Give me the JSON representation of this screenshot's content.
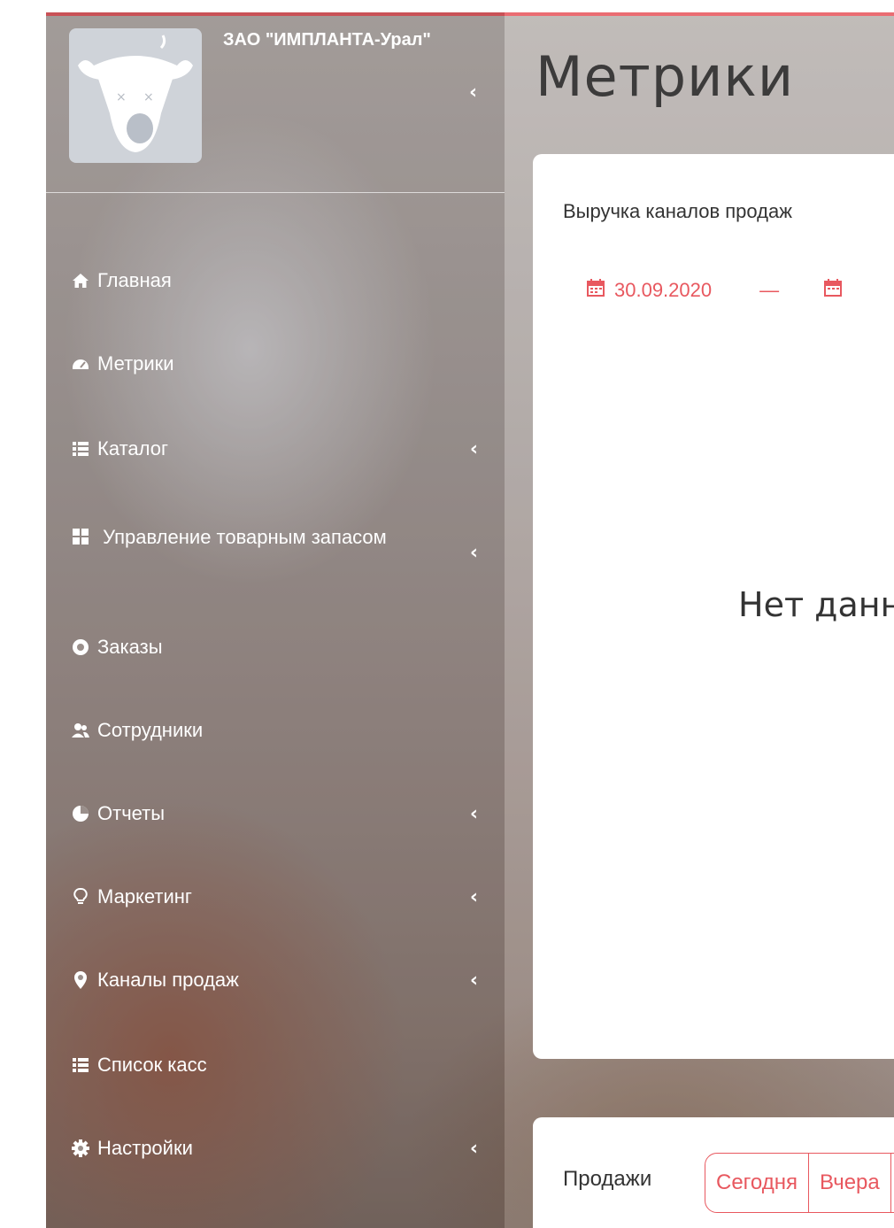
{
  "org": {
    "name": "ЗАО \"ИМПЛАНТА-Урал\""
  },
  "page": {
    "title": "Метрики"
  },
  "sidebar": {
    "items": [
      {
        "label": "Главная",
        "icon": "home-icon",
        "has_submenu": false
      },
      {
        "label": "Метрики",
        "icon": "gauge-icon",
        "has_submenu": false
      },
      {
        "label": "Каталог",
        "icon": "list-icon",
        "has_submenu": true
      },
      {
        "label": "Управление товарным запасом",
        "icon": "grid-icon",
        "has_submenu": true
      },
      {
        "label": "Заказы",
        "icon": "life-ring-icon",
        "has_submenu": false
      },
      {
        "label": "Сотрудники",
        "icon": "users-icon",
        "has_submenu": false
      },
      {
        "label": "Отчеты",
        "icon": "pie-chart-icon",
        "has_submenu": true
      },
      {
        "label": "Маркетинг",
        "icon": "lightbulb-icon",
        "has_submenu": true
      },
      {
        "label": "Каналы продаж",
        "icon": "map-marker-icon",
        "has_submenu": true
      },
      {
        "label": "Список касс",
        "icon": "list-icon",
        "has_submenu": false
      },
      {
        "label": "Настройки",
        "icon": "gear-icon",
        "has_submenu": true
      }
    ]
  },
  "revenue_card": {
    "title": "Выручка каналов продаж",
    "date_from": "30.09.2020",
    "date_separator": "—",
    "empty_text": "Нет данных"
  },
  "sales_card": {
    "label": "Продажи",
    "periods": [
      "Сегодня",
      "Вчера"
    ]
  },
  "colors": {
    "accent": "#e8585f",
    "title_text": "#3c3b3b"
  }
}
